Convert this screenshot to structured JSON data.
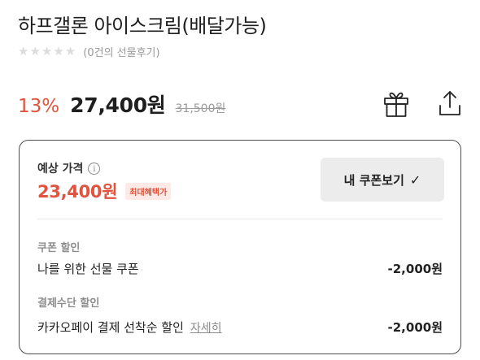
{
  "product": {
    "title": "하프갤론 아이스크림(배달가능)",
    "review_text": "(0건의 선물후기)",
    "rating_stars": 0,
    "rating_max": 5
  },
  "price": {
    "discount": "13%",
    "sale": "27,400원",
    "original": "31,500원"
  },
  "icons": {
    "gift": "gift-icon",
    "share": "share-icon",
    "info": "info-icon",
    "check": "check-icon"
  },
  "estimate": {
    "label": "예상 가격",
    "info_glyph": "i",
    "price": "23,400원",
    "badge": "최대혜택가",
    "coupon_button": "내 쿠폰보기",
    "check_glyph": "✓"
  },
  "discounts": [
    {
      "section": "쿠폰 할인",
      "item": "나를 위한 선물 쿠폰",
      "amount": "-2,000원"
    },
    {
      "section": "결제수단 할인",
      "item": "카카오페이 결제 선착순 할인",
      "link": "자세히",
      "amount": "-2,000원"
    }
  ],
  "colors": {
    "accent": "#e0533e",
    "badge_bg": "#fde9e6",
    "button_bg": "#ececec",
    "star_empty": "#dcdcdc"
  }
}
